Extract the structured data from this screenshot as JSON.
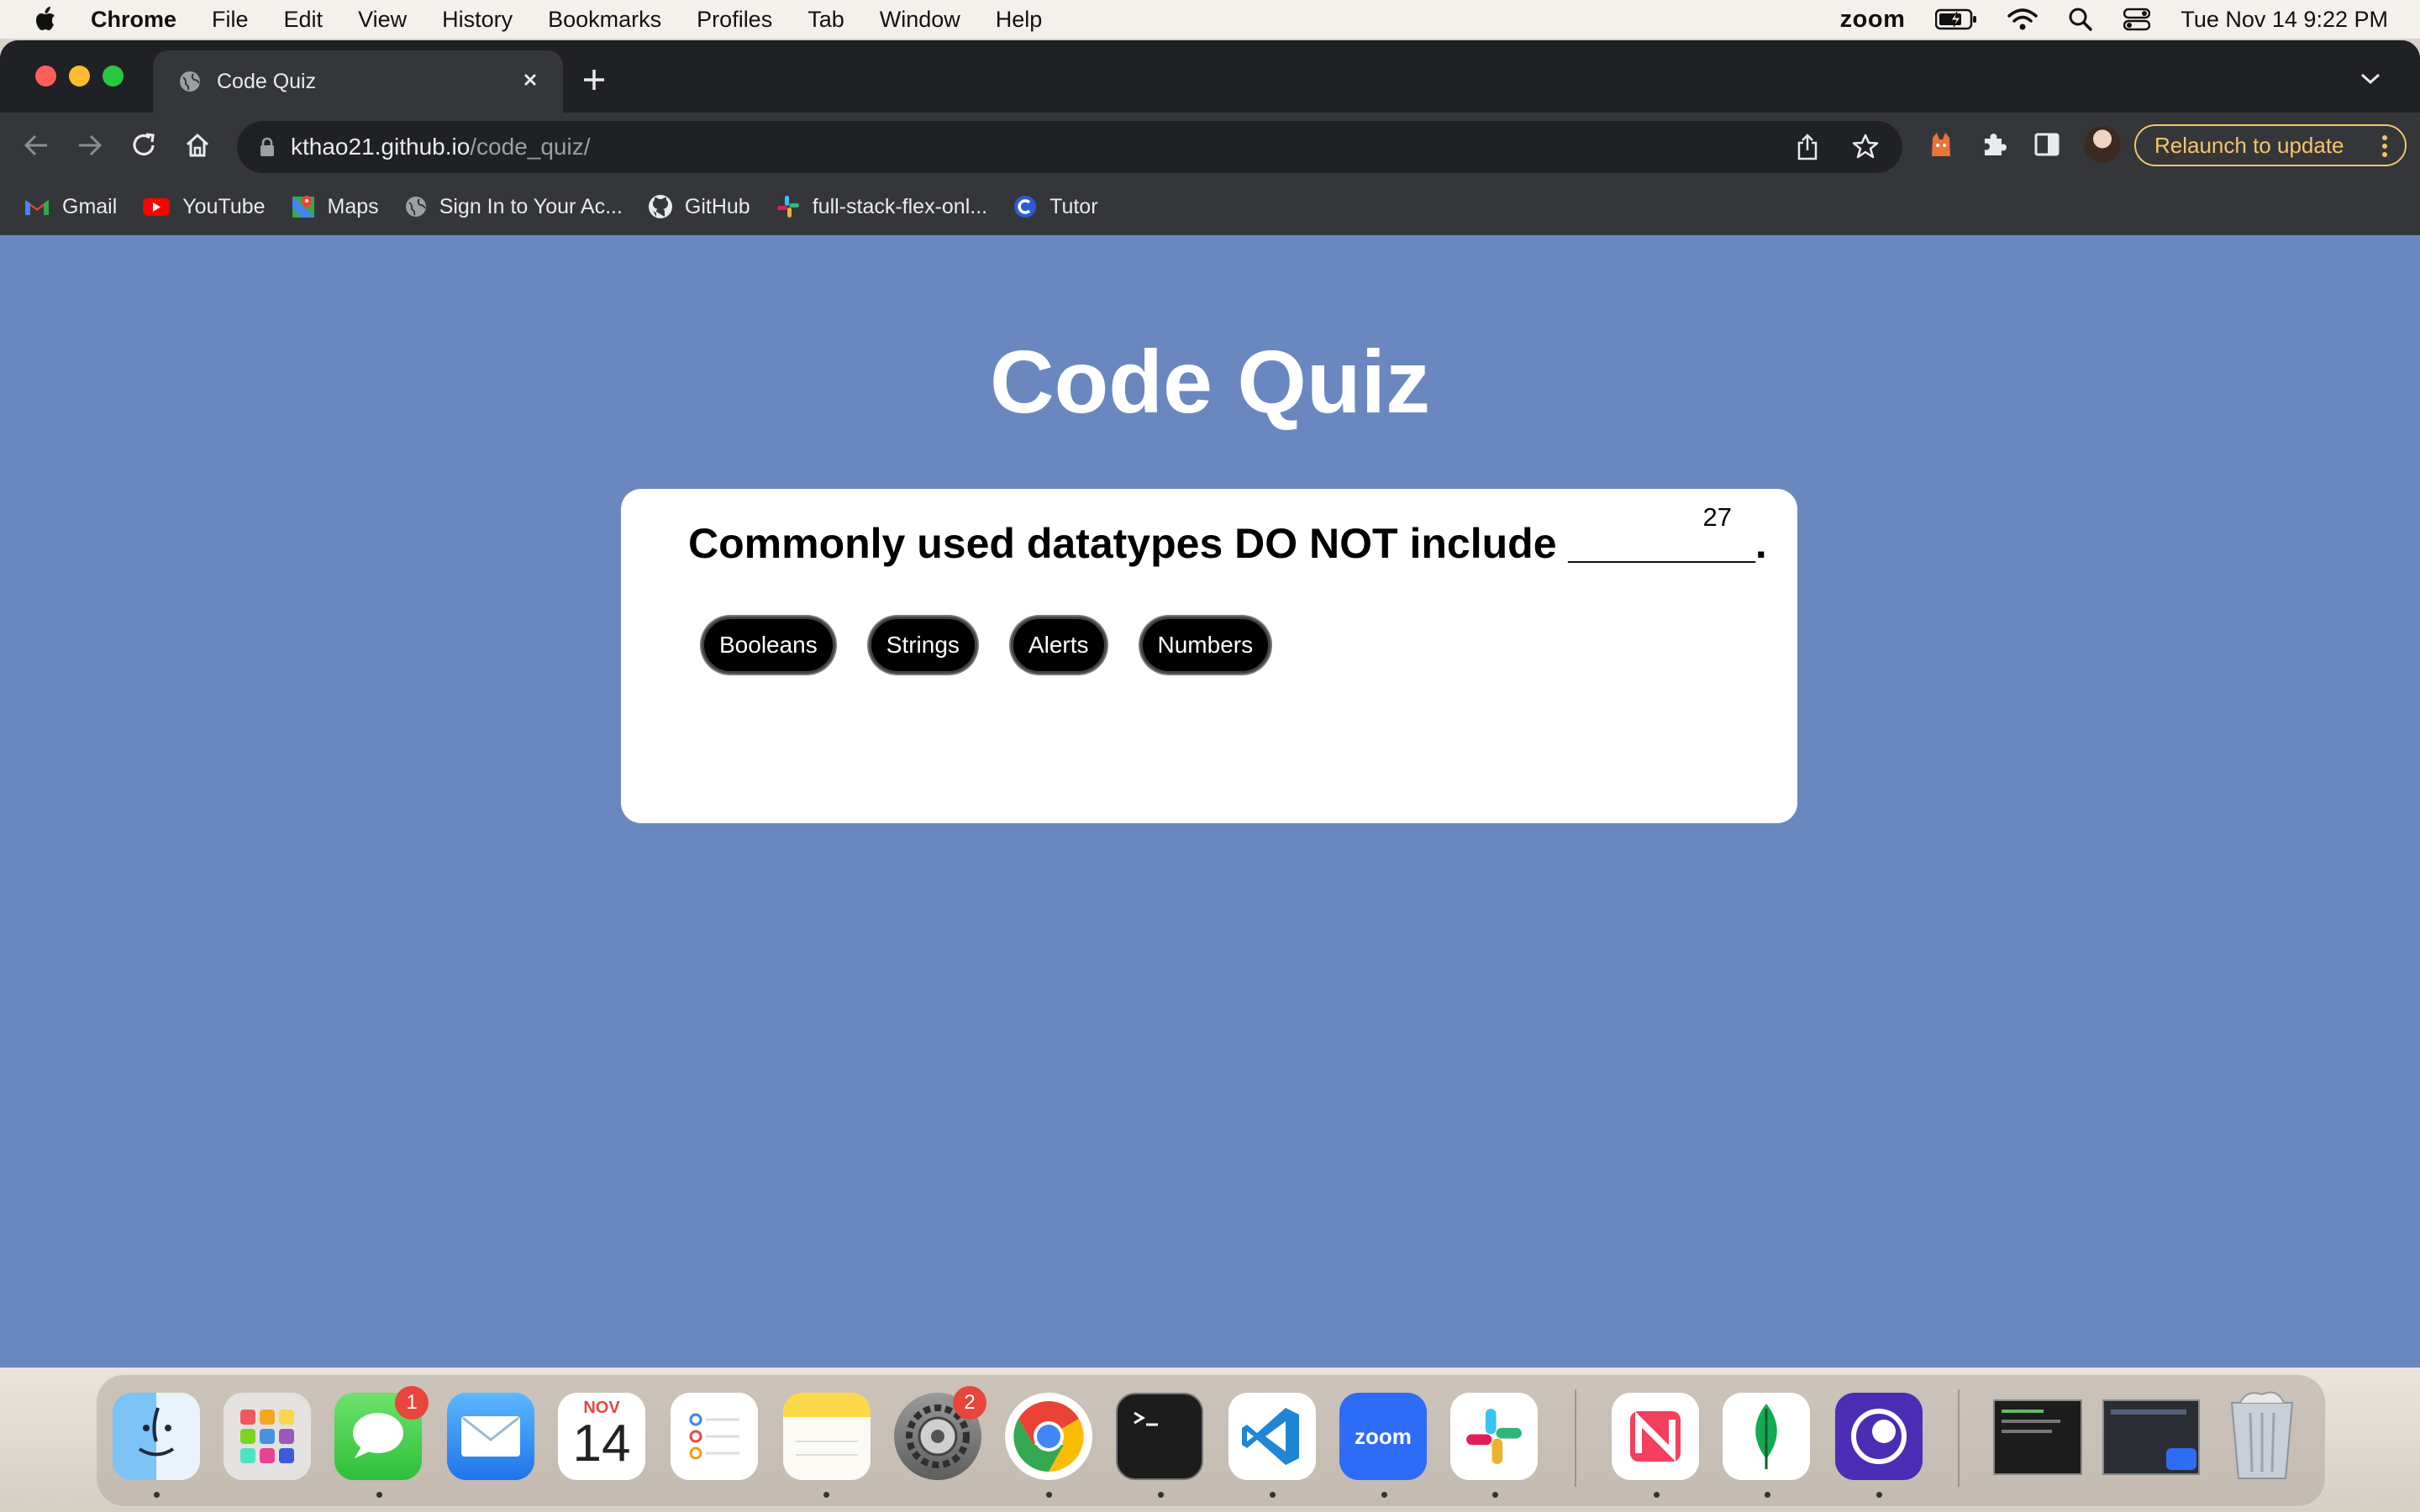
{
  "menubar": {
    "app_name": "Chrome",
    "items": [
      "File",
      "Edit",
      "View",
      "History",
      "Bookmarks",
      "Profiles",
      "Tab",
      "Window",
      "Help"
    ],
    "zoom_label": "zoom",
    "datetime": "Tue Nov 14  9:22 PM"
  },
  "browser": {
    "tab_title": "Code Quiz",
    "url_host": "kthao21.github.io",
    "url_path": "/code_quiz/",
    "relaunch_label": "Relaunch to update",
    "bookmarks": [
      "Gmail",
      "YouTube",
      "Maps",
      "Sign In to Your Ac...",
      "GitHub",
      "full-stack-flex-onl...",
      "Tutor"
    ]
  },
  "page": {
    "title": "Code Quiz",
    "timer": "27",
    "question": "Commonly used datatypes DO NOT include ________.",
    "answers": [
      "Booleans",
      "Strings",
      "Alerts",
      "Numbers"
    ]
  },
  "dock": {
    "apps": [
      "Finder",
      "Launchpad",
      "Messages",
      "Mail",
      "Calendar",
      "Reminders",
      "Notes",
      "System Settings",
      "Google Chrome",
      "Terminal",
      "Visual Studio Code",
      "zoom",
      "Slack",
      "News",
      "MongoDB Compass",
      "Tor Browser"
    ],
    "calendar_month": "NOV",
    "calendar_day": "14",
    "messages_badge": "1",
    "settings_badge": "2",
    "zoom_label": "zoom"
  },
  "colors": {
    "page_background": "#6a88bf",
    "card_background": "#ffffff",
    "answer_button": "#000000",
    "relaunch_accent": "#f3c56a"
  }
}
